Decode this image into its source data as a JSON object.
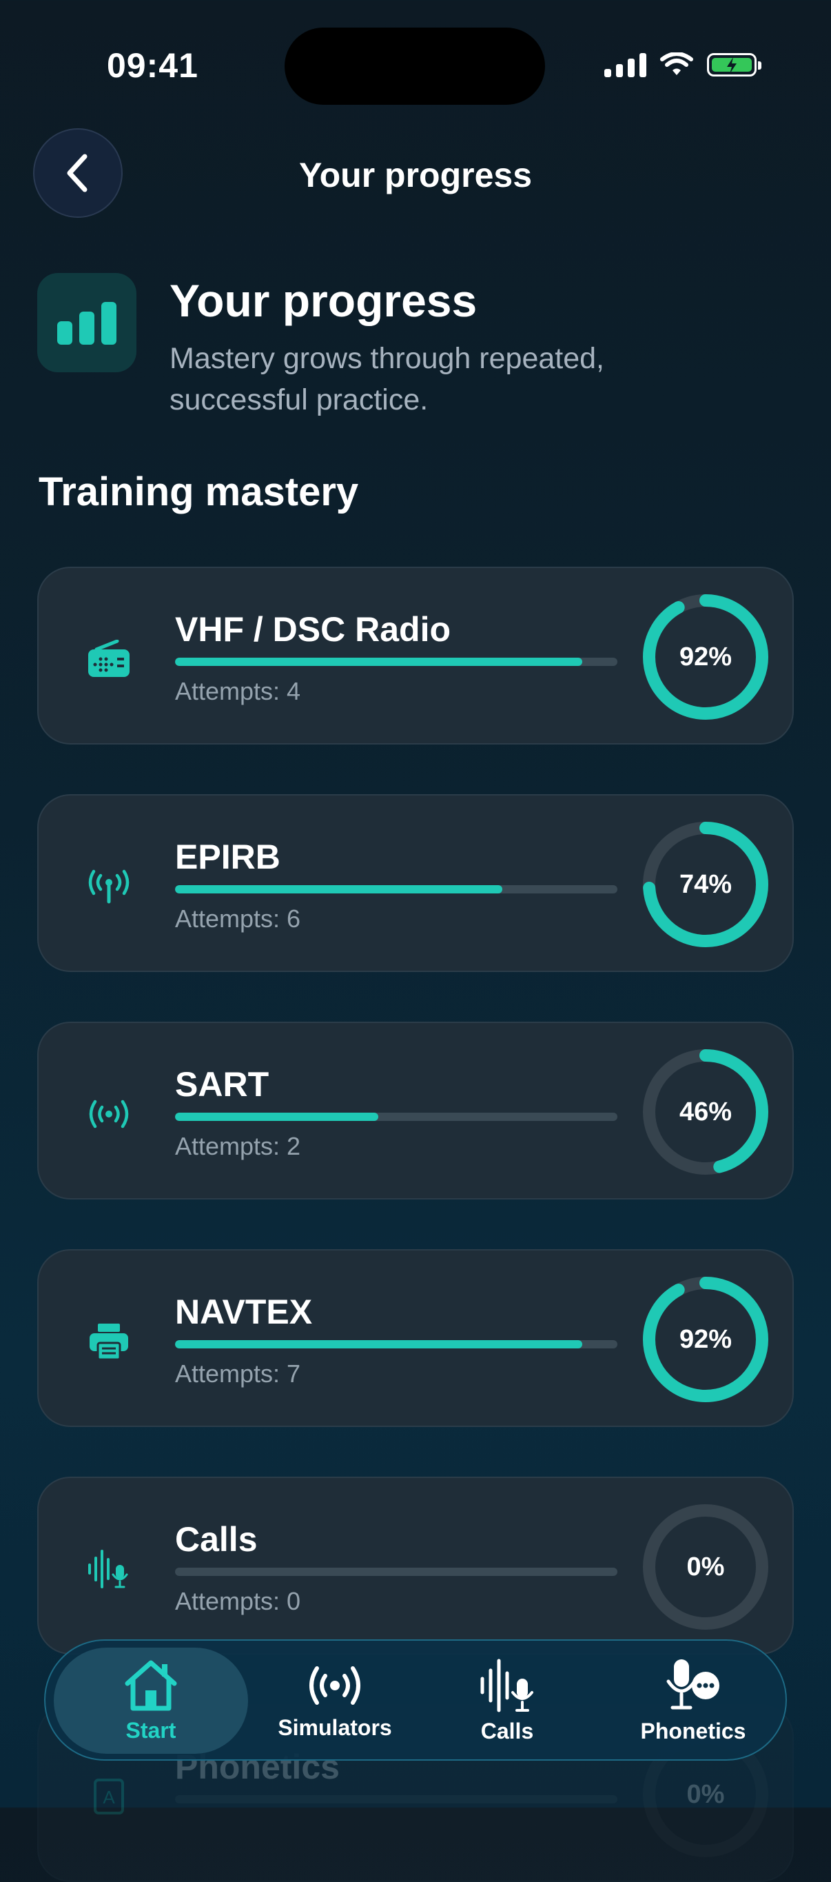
{
  "status_bar": {
    "time": "09:41"
  },
  "header": {
    "title": "Your progress"
  },
  "hero": {
    "title": "Your progress",
    "subtitle": "Mastery grows through repeated, successful practice."
  },
  "section": {
    "title": "Training mastery"
  },
  "modules": [
    {
      "name": "VHF / DSC Radio",
      "attempts": "Attempts: 4",
      "percent_label": "92%",
      "mastery": 0.92,
      "icon": "radio-icon"
    },
    {
      "name": "EPIRB",
      "attempts": "Attempts: 6",
      "percent_label": "74%",
      "mastery": 0.74,
      "icon": "antenna-icon"
    },
    {
      "name": "SART",
      "attempts": "Attempts: 2",
      "percent_label": "46%",
      "mastery": 0.46,
      "icon": "broadcast-icon"
    },
    {
      "name": "NAVTEX",
      "attempts": "Attempts: 7",
      "percent_label": "92%",
      "mastery": 0.92,
      "icon": "printer-icon"
    },
    {
      "name": "Calls",
      "attempts": "Attempts: 0",
      "percent_label": "0%",
      "mastery": 0.0,
      "icon": "voice-wave-icon"
    },
    {
      "name": "Phonetics",
      "attempts": "",
      "percent_label": "0%",
      "mastery": 0.0,
      "icon": "alphabet-book-icon"
    }
  ],
  "tabbar": {
    "tabs": [
      {
        "label": "Start",
        "icon": "home-icon",
        "active": true
      },
      {
        "label": "Simulators",
        "icon": "broadcast-icon",
        "active": false
      },
      {
        "label": "Calls",
        "icon": "voice-mic-icon",
        "active": false
      },
      {
        "label": "Phonetics",
        "icon": "speaker-chat-icon",
        "active": false
      }
    ]
  },
  "colors": {
    "accent": "#1fc9b5",
    "track": "#3a4a55",
    "card": "#1f2d38"
  }
}
